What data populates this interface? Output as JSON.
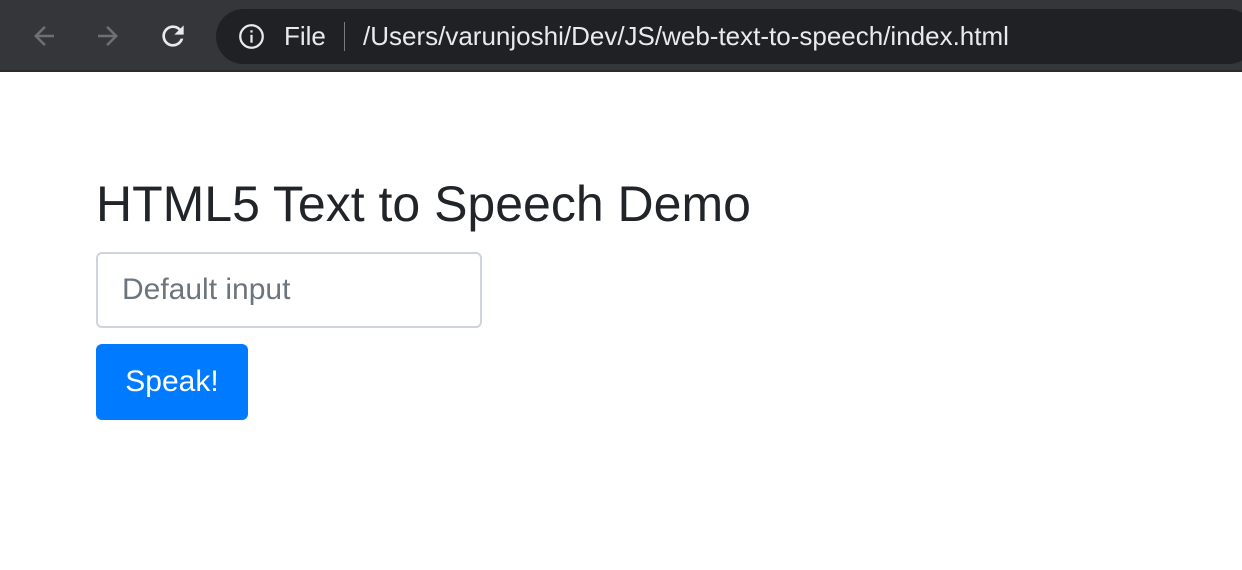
{
  "browser": {
    "scheme_label": "File",
    "url": "/Users/varunjoshi/Dev/JS/web-text-to-speech/index.html",
    "icons": {
      "back": "arrow-left-icon",
      "forward": "arrow-right-icon",
      "reload": "reload-icon",
      "info": "info-icon"
    }
  },
  "page": {
    "title": "HTML5 Text to Speech Demo",
    "input": {
      "value": "",
      "placeholder": "Default input"
    },
    "speak_button_label": "Speak!"
  },
  "colors": {
    "primary_button": "#007bff",
    "title_text": "#212529",
    "browser_toolbar": "#35363a",
    "omnibox": "#202124"
  }
}
